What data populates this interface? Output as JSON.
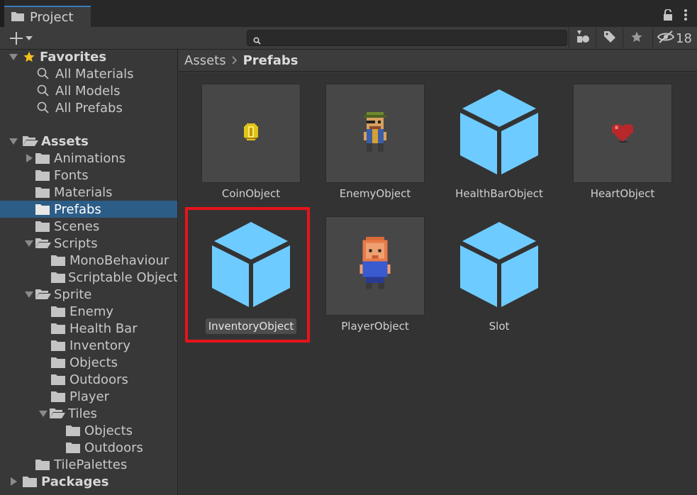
{
  "window": {
    "tab_title": "Project",
    "hidden_count": "18"
  },
  "toolbar": {
    "search_placeholder": ""
  },
  "favorites": {
    "label": "Favorites",
    "items": [
      {
        "label": "All Materials"
      },
      {
        "label": "All Models"
      },
      {
        "label": "All Prefabs"
      }
    ]
  },
  "assets": {
    "label": "Assets",
    "children": {
      "animations": "Animations",
      "fonts": "Fonts",
      "materials": "Materials",
      "prefabs": "Prefabs",
      "scenes": "Scenes",
      "scripts": "Scripts",
      "mono_behaviour": "MonoBehaviour",
      "scriptable_object": "Scriptable Object",
      "sprite": "Sprite",
      "enemy": "Enemy",
      "health_bar": "Health Bar",
      "inventory": "Inventory",
      "objects": "Objects",
      "outdoors": "Outdoors",
      "player": "Player",
      "tiles": "Tiles",
      "tiles_objects": "Objects",
      "tiles_outdoors": "Outdoors",
      "tile_palettes": "TilePalettes"
    }
  },
  "packages": {
    "label": "Packages"
  },
  "breadcrumb": {
    "root": "Assets",
    "current": "Prefabs"
  },
  "grid_items": [
    {
      "label": "CoinObject"
    },
    {
      "label": "EnemyObject"
    },
    {
      "label": "HealthBarObject"
    },
    {
      "label": "HeartObject"
    },
    {
      "label": "InventoryObject"
    },
    {
      "label": "PlayerObject"
    },
    {
      "label": "Slot"
    }
  ],
  "colors": {
    "selection": "#2c5d87",
    "prefab_cube": "#6ecbff",
    "highlight": "#e8131a",
    "favorite_star": "#f3c020"
  }
}
